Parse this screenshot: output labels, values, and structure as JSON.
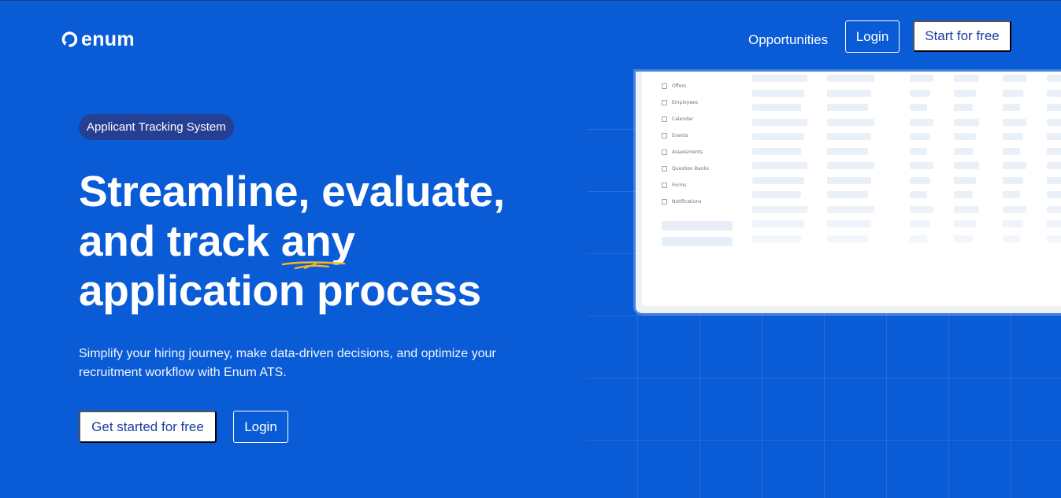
{
  "brand": {
    "name": "enum"
  },
  "nav": {
    "opportunities": "Opportunities",
    "login": "Login",
    "start": "Start for free"
  },
  "hero": {
    "badge": "Applicant Tracking System",
    "headline_line1": "Streamline, evaluate,",
    "headline_line2_pre": "and track ",
    "headline_highlight": "any",
    "headline_line3": "application process",
    "subtext": "Simplify your hiring journey, make data-driven decisions, and optimize your recruitment workflow with Enum ATS.",
    "cta_primary": "Get started for free",
    "cta_secondary": "Login"
  },
  "preview": {
    "menu": [
      "Offers",
      "Employees",
      "Calendar",
      "Events",
      "Assessments",
      "Question Banks",
      "Forms",
      "Notifications"
    ]
  },
  "colors": {
    "background": "#0a5bd6",
    "badge": "#253f92",
    "accent_underline": "#f5b32a",
    "button_text": "#1a3e9e"
  }
}
